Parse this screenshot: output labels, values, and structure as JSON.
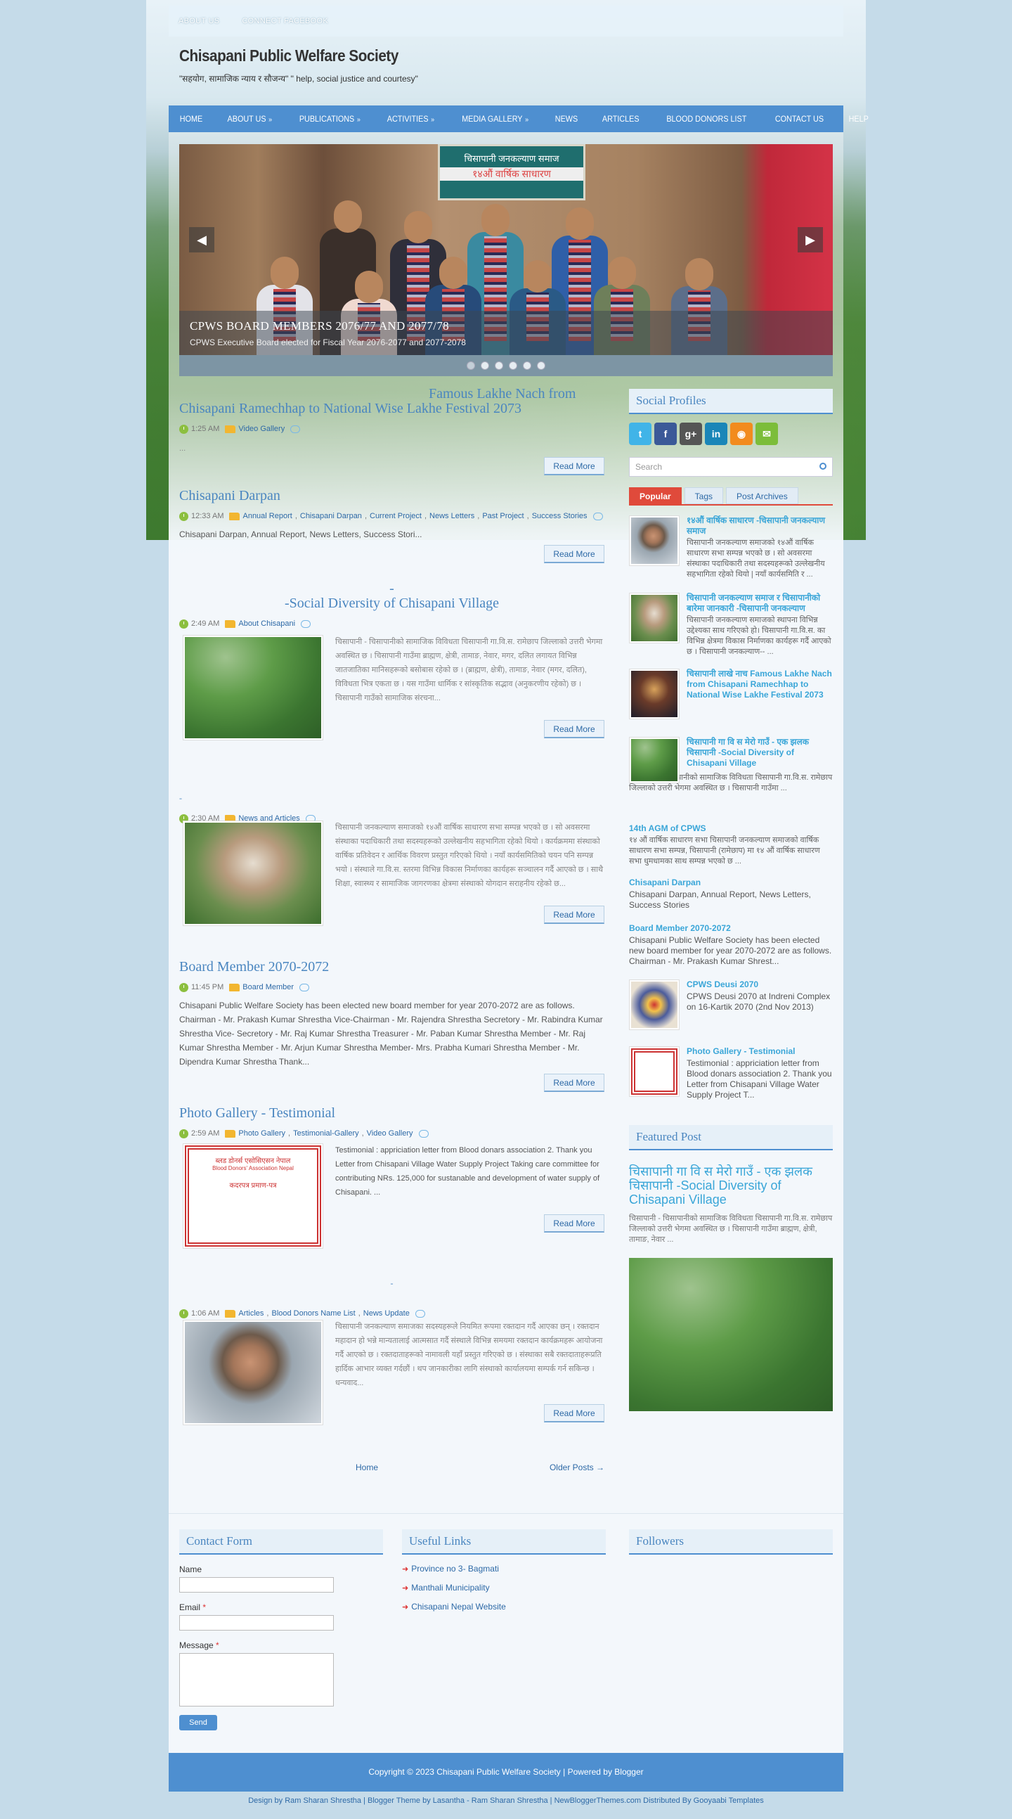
{
  "topbar": {
    "links": [
      "ABOUT US",
      "CONNECT FACEBOOK"
    ]
  },
  "site": {
    "title": "Chisapani Public Welfare Society",
    "description": "\"सहयोग, सामाजिक न्याय र सौजन्य\" \" help, social justice and courtesy\""
  },
  "nav": {
    "items": [
      "HOME",
      "ABOUT US",
      "PUBLICATIONS",
      "ACTIVITIES",
      "MEDIA GALLERY",
      "NEWS",
      "ARTICLES",
      "BLOOD DONORS LIST",
      "CONTACT US",
      "HELP"
    ],
    "dropdown_marker": "»"
  },
  "slider": {
    "banner_line1": "चिसापानी जनकल्याण समाज",
    "banner_line2": "१४औं वार्षिक साधारण",
    "caption_title": "CPWS BOARD MEMBERS 2076/77 AND 2077/78",
    "caption_text": "CPWS Executive Board elected for Fiscal Year 2076-2077 and 2077-2078",
    "prev": "◀",
    "next": "▶",
    "dots": 6,
    "active_dot": 0
  },
  "posts": [
    {
      "title_line1": "Famous Lakhe Nach from",
      "title_line2": "Chisapani Ramechhap to National Wise Lakhe Festival 2073",
      "time": "1:25 AM",
      "labels": [
        "Video Gallery"
      ],
      "snippet": "...",
      "readmore": "Read More"
    },
    {
      "title": "Chisapani Darpan",
      "time": "12:33 AM",
      "labels": [
        "Annual Report",
        "Chisapani Darpan",
        "Current Project",
        "News Letters",
        "Past Project",
        "Success Stories"
      ],
      "snippet": "Chisapani Darpan, Annual Report, News Letters, Success Stori...",
      "readmore": "Read More"
    },
    {
      "title_line1": "-",
      "title_line2": "-Social Diversity of Chisapani Village",
      "time": "2:49 AM",
      "labels": [
        "About Chisapani"
      ],
      "snippet": "चिसापानी - चिसापानीको सामाजिक विविधता चिसापानी गा.वि.स. रामेछाप जिल्लाको उत्तरी भेगमा अवस्थित छ । चिसापानी गाउँमा ब्राह्मण, क्षेत्री, तामाङ, नेवार, मगर, दलित लगायत विभिन्न जातजातिका मानिसहरूको बसोबास रहेको छ । (ब्राह्मण, क्षेत्री), तामाङ, नेवार (मगर, दलित), विविधता भित्र एकता छ । यस गाउँमा धार्मिक र सांस्कृतिक सद्भाव (अनुकरणीय रहेको) छ । चिसापानी गाउँको सामाजिक संरचना...",
      "readmore": "Read More"
    },
    {
      "title": "-",
      "time": "2:30 AM",
      "labels": [
        "News and Articles"
      ],
      "snippet": "चिसापानी जनकल्याण समाजको १४औं वार्षिक साधारण सभा सम्पन्न भएको छ । सो अवसरमा संस्थाका पदाधिकारी तथा सदस्यहरूको उल्लेखनीय सहभागिता रहेको थियो । कार्यक्रममा संस्थाको वार्षिक प्रतिवेदन र आर्थिक विवरण प्रस्तुत गरिएको थियो । नयाँ कार्यसमितिको चयन पनि सम्पन्न भयो । संस्थाले गा.वि.स. स्तरमा विभिन्न विकास निर्माणका कार्यहरू सञ्चालन गर्दै आएको छ । साथै शिक्षा, स्वास्थ्य र सामाजिक जागरणका क्षेत्रमा संस्थाको योगदान सराहनीय रहेको छ...",
      "readmore": "Read More"
    },
    {
      "title": "Board Member 2070-2072",
      "time": "11:45 PM",
      "labels": [
        "Board Member"
      ],
      "snippet": "Chisapani Public Welfare Society has been elected new board member for year 2070-2072 are as follows. Chairman - Mr. Prakash Kumar Shrestha Vice-Chairman - Mr. Rajendra Shrestha Secretory - Mr. Rabindra Kumar Shrestha Vice- Secretory - Mr. Raj Kumar Shrestha  Treasurer - Mr. Paban Kumar Shrestha Member - Mr. Raj Kumar Shrestha Member - Mr. Arjun Kumar Shrestha Member- Mrs. Prabha Kumari Shrestha Member - Mr. Dipendra Kumar Shrestha Thank...",
      "readmore": "Read More"
    },
    {
      "title": "Photo Gallery - Testimonial",
      "time": "2:59 AM",
      "labels": [
        "Photo Gallery",
        "Testimonial-Gallery",
        "Video Gallery"
      ],
      "snippet": "Testimonial : appriciation letter from Blood donars association 2. Thank you Letter from Chisapani Village Water Supply Project Taking care committee for contributing NRs. 125,000 for sustanable and development of water supply of Chisapani. ...",
      "readmore": "Read More",
      "cert_line1": "ब्लड डोनर्स एसोसिएसन नेपाल",
      "cert_line2": "Blood Donors' Association Nepal",
      "cert_line3": "कदरपत्र प्रमाण-पत्र"
    },
    {
      "title": "-",
      "time": "1:06 AM",
      "labels": [
        "Articles",
        "Blood Donors Name List",
        "News Update"
      ],
      "snippet": "चिसापानी जनकल्याण समाजका सदस्यहरूले नियमित रूपमा रक्तदान गर्दै आएका छन् । रक्तदान महादान हो भन्ने मान्यतालाई आत्मसात गर्दै संस्थाले विभिन्न समयमा रक्तदान कार्यक्रमहरू आयोजना गर्दै आएको छ । रक्तदाताहरूको नामावली यहाँ प्रस्तुत गरिएको छ । संस्थाका सबै रक्तदाताहरूप्रति हार्दिक आभार व्यक्त गर्दछौं । थप जानकारीका लागि संस्थाको कार्यालयमा सम्पर्क गर्न सकिन्छ । धन्यवाद...",
      "readmore": "Read More"
    }
  ],
  "pager": {
    "home": "Home",
    "older": "Older Posts →"
  },
  "sidebar": {
    "social_title": "Social Profiles",
    "social_icons": [
      "twitter-icon",
      "facebook-icon",
      "googleplus-icon",
      "linkedin-icon",
      "rss-icon",
      "email-icon"
    ],
    "social_glyphs": [
      "t",
      "f",
      "g+",
      "in",
      "◉",
      "✉"
    ],
    "social_colors": [
      "#40b4e8",
      "#3b5998",
      "#555555",
      "#1a86b8",
      "#f28b1e",
      "#7cbd3a"
    ],
    "search_placeholder": "Search",
    "tabs": [
      "Popular",
      "Tags",
      "Post Archives"
    ],
    "popular": [
      {
        "title": "१४औं वार्षिक साधारण -चिसापानी जनकल्याण समाज",
        "text": "चिसापानी जनकल्याण समाजको १४औं वार्षिक साधारण सभा सम्पन्न भएको छ । सो अवसरमा संस्थाका पदाधिकारी तथा सदस्यहरूको उल्लेखनीय सहभागिता रहेको थियो | नयाँ कार्यसमिति र ..."
      },
      {
        "title": "चिसापानी जनकल्याण समाज र चिसापानीको बारेमा जानकारी -चिसापानी जनकल्याण",
        "text": "चिसापानी जनकल्याण समाजको स्थापना विभिन्न उद्देश्यका साथ गरिएको हो। चिसापानी गा.वि.स. का विभिन्न क्षेत्रमा विकास निर्माणका कार्यहरू गर्दै आएको छ । चिसापानी जनकल्याण-- ..."
      },
      {
        "title": "चिसापानी लाखे नाच Famous Lakhe Nach from Chisapani Ramechhap to National Wise Lakhe Festival 2073",
        "text": ""
      },
      {
        "title": "चिसापानी गा वि स मेरो गाउँ - एक झलक चिसापानी -Social Diversity of Chisapani Village",
        "text": "चिसापानी - चिसापानीको सामाजिक विविधता चिसापानी गा.वि.स. रामेछाप जिल्लाको उत्तरी भेगमा अवस्थित छ । चिसापानी गाउँमा ..."
      },
      {
        "title": "14th AGM of CPWS",
        "text": "१४ औं वार्षिक साधारण सभा चिसापानी जनकल्याण समाजको वार्षिक साधारण सभा सम्पन्न, चिसापानी (रामेछाप) मा १४ औं वार्षिक साधारण सभा धुमधामका साथ सम्पन्न भएको छ ..."
      },
      {
        "title": "Chisapani Darpan",
        "text": "Chisapani Darpan, Annual Report, News Letters, Success Stories"
      },
      {
        "title": "Board Member 2070-2072",
        "text": "Chisapani Public Welfare Society has been elected new board member for year 2070-2072 are as follows. Chairman - Mr. Prakash Kumar Shrest..."
      },
      {
        "title": "CPWS Deusi 2070",
        "text": "CPWS Deusi 2070 at Indreni Complex on 16-Kartik 2070 (2nd Nov 2013)"
      },
      {
        "title": "Photo Gallery - Testimonial",
        "text": "Testimonial : appriciation letter from Blood donars association 2. Thank you Letter from Chisapani Village Water Supply Project T..."
      }
    ],
    "featured_title": "Featured Post",
    "featured_post_title": "चिसापानी गा वि स मेरो गाउँ - एक झलक चिसापानी -Social Diversity of Chisapani Village",
    "featured_post_text": "चिसापानी - चिसापानीको सामाजिक विविधता चिसापानी गा.वि.स. रामेछाप जिल्लाको उत्तरी भेगमा अवस्थित छ । चिसापानी गाउँमा ब्राह्मण, क्षेत्री, तामाङ, नेवार ..."
  },
  "footer": {
    "contact_title": "Contact Form",
    "name_label": "Name",
    "email_label": "Email",
    "message_label": "Message",
    "required_marker": "*",
    "send": "Send",
    "links_title": "Useful Links",
    "links": [
      "Province no 3- Bagmati",
      "Manthali Municipality",
      "Chisapani Nepal Website"
    ],
    "followers_title": "Followers",
    "copyright": "Copyright © 2023 Chisapani Public Welfare Society | Powered by Blogger",
    "credits": "Design by Ram Sharan Shrestha | Blogger Theme by Lasantha - Ram Sharan Shrestha | NewBloggerThemes.com Distributed By Gooyaabi Templates"
  }
}
